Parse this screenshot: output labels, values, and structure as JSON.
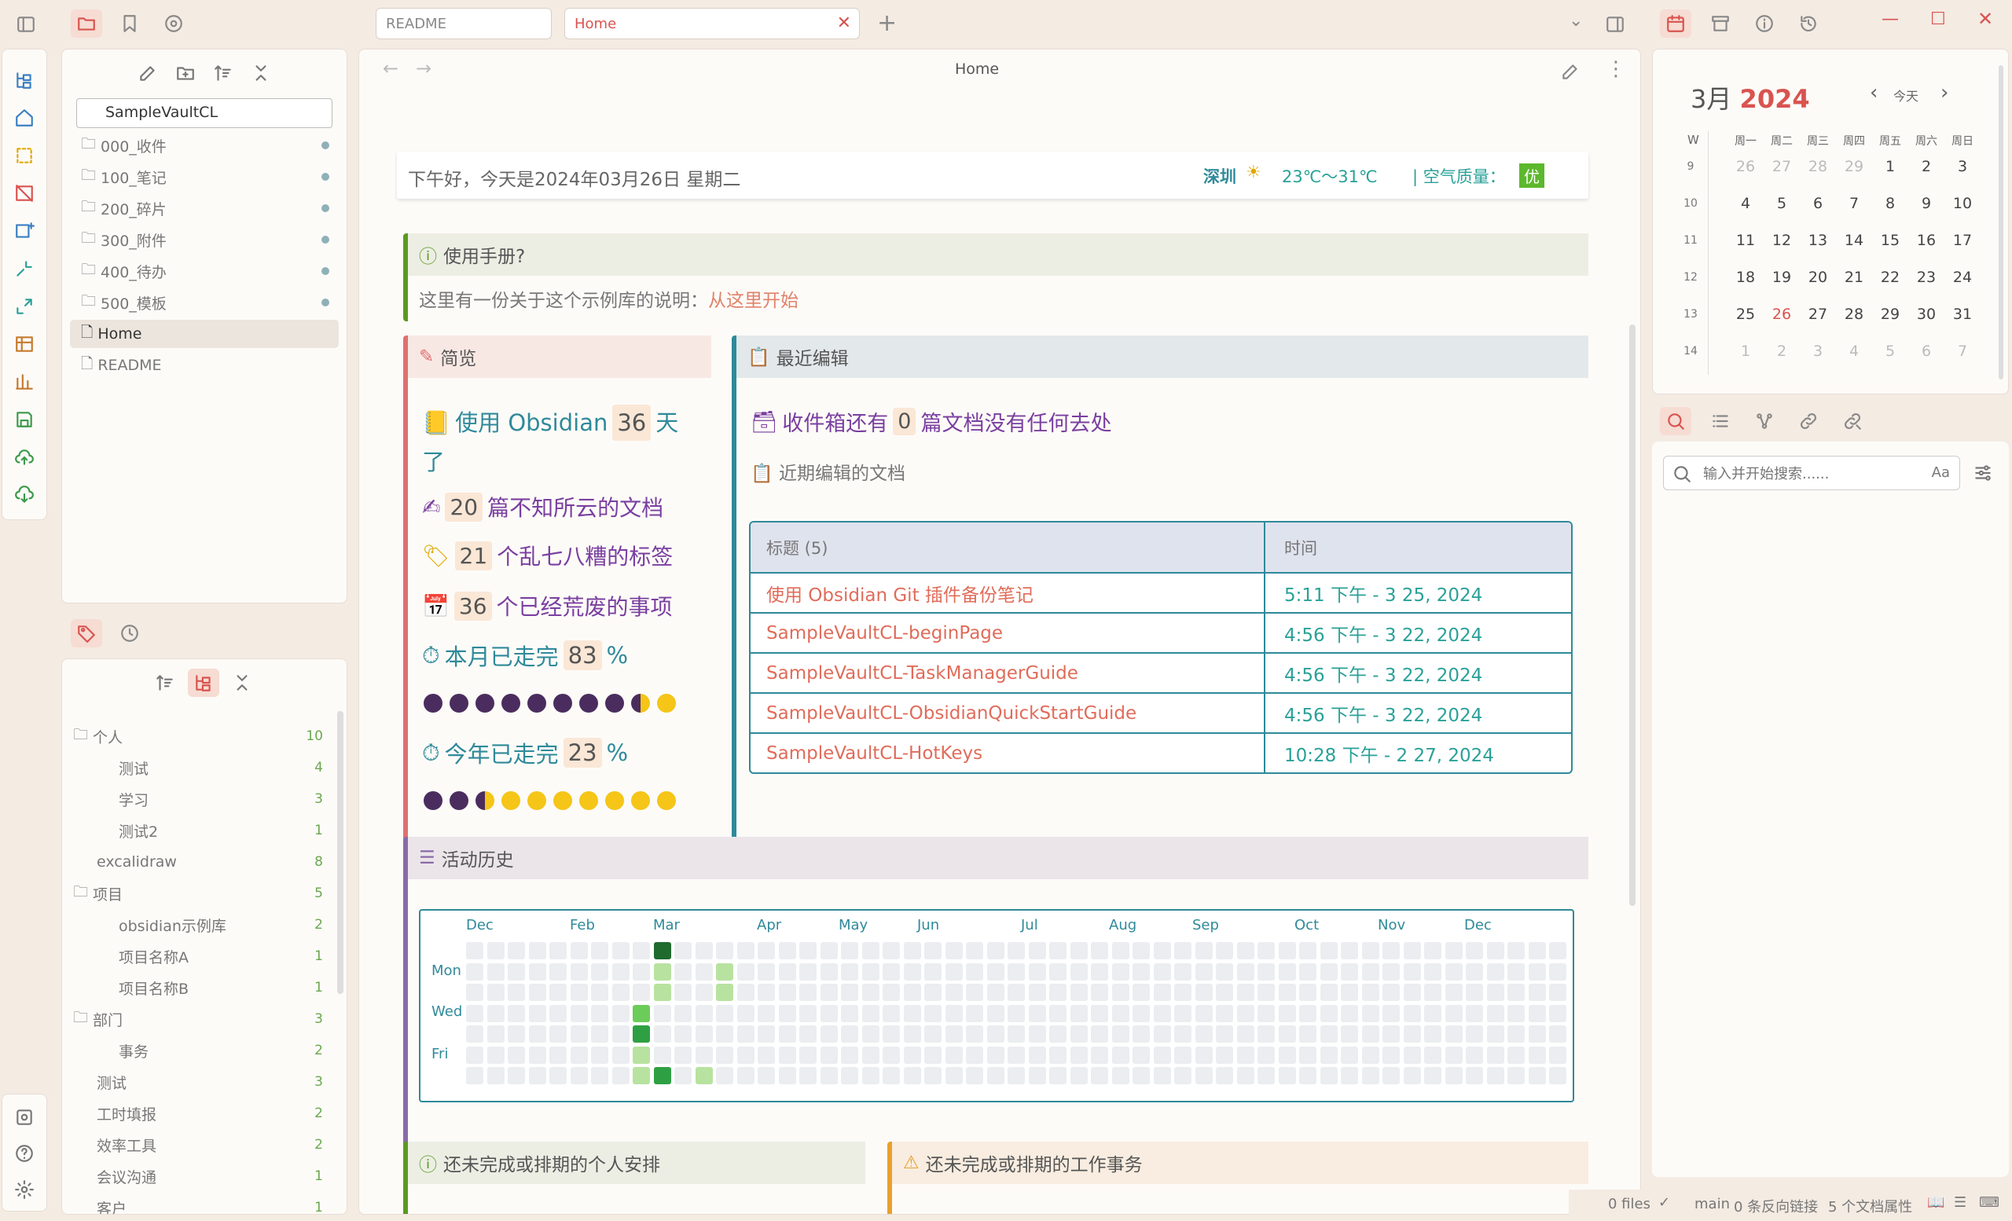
{
  "tabs": [
    {
      "label": "README"
    },
    {
      "label": "Home"
    }
  ],
  "file_tree": {
    "vault": "SampleVaultCL",
    "folders": [
      "000_收件",
      "100_笔记",
      "200_碎片",
      "300_附件",
      "400_待办",
      "500_模板"
    ],
    "files": [
      "Home",
      "README"
    ]
  },
  "tags": [
    {
      "label": "个人",
      "count": "10"
    },
    {
      "label": "测试",
      "count": "4"
    },
    {
      "label": "学习",
      "count": "3"
    },
    {
      "label": "测试2",
      "count": "1"
    },
    {
      "label": "excalidraw",
      "count": "8"
    },
    {
      "label": "项目",
      "count": "5"
    },
    {
      "label": "obsidian示例库",
      "count": "2"
    },
    {
      "label": "项目名称A",
      "count": "1"
    },
    {
      "label": "项目名称B",
      "count": "1"
    },
    {
      "label": "部门",
      "count": "3"
    },
    {
      "label": "事务",
      "count": "2"
    },
    {
      "label": "测试",
      "count": "3"
    },
    {
      "label": "工时填报",
      "count": "2"
    },
    {
      "label": "效率工具",
      "count": "2"
    },
    {
      "label": "会议沟通",
      "count": "1"
    },
    {
      "label": "客户",
      "count": "1"
    }
  ],
  "note": {
    "title": "Home"
  },
  "greeting": {
    "text": "下午好，今天是2024年03月26日 星期二",
    "city": "深圳",
    "temp": "23℃～31℃",
    "aq_label": "| 空气质量：",
    "aq_value": "优"
  },
  "manual": {
    "title": "使用手册?",
    "text": "这里有一份关于这个示例库的说明：",
    "link": "从这里开始"
  },
  "overview": {
    "title": "简览",
    "s1a": "使用 Obsidian",
    "s1n": "36",
    "s1b": "天",
    "s1c": "了",
    "s2n": "20",
    "s2": "篇不知所云的文档",
    "s3n": "21",
    "s3": "个乱七八糟的标签",
    "s4n": "36",
    "s4": "个已经荒废的事项",
    "s5a": "本月已走完",
    "s5n": "83",
    "s5b": "%",
    "s6a": "今年已走完",
    "s6n": "23",
    "s6b": "%"
  },
  "recent": {
    "title": "最近编辑",
    "inbox_a": "收件箱还有",
    "inbox_n": "0",
    "inbox_b": "篇文档没有任何去处",
    "sub": "近期编辑的文档",
    "col1": "标题 (5)",
    "col2": "时间",
    "rows": [
      {
        "t": "使用 Obsidian Git 插件备份笔记",
        "d": "5:11 下午 - 3 25, 2024"
      },
      {
        "t": "SampleVaultCL-beginPage",
        "d": "4:56 下午 - 3 22, 2024"
      },
      {
        "t": "SampleVaultCL-TaskManagerGuide",
        "d": "4:56 下午 - 3 22, 2024"
      },
      {
        "t": "SampleVaultCL-ObsidianQuickStartGuide",
        "d": "4:56 下午 - 3 22, 2024"
      },
      {
        "t": "SampleVaultCL-HotKeys",
        "d": "10:28 下午 - 2 27, 2024"
      }
    ]
  },
  "history": {
    "title": "活动历史",
    "months": [
      "Dec",
      "Feb",
      "Mar",
      "Apr",
      "May",
      "Jun",
      "Jul",
      "Aug",
      "Sep",
      "Oct",
      "Nov",
      "Dec"
    ],
    "days": [
      "Mon",
      "Wed",
      "Fri"
    ]
  },
  "personal": {
    "title": "还未完成或排期的个人安排"
  },
  "work": {
    "title": "还未完成或排期的工作事务"
  },
  "calendar": {
    "month": "3月",
    "year": "2024",
    "today": "今天",
    "week_label": "W",
    "weekdays": [
      "周一",
      "周二",
      "周三",
      "周四",
      "周五",
      "周六",
      "周日"
    ],
    "weeks": [
      {
        "w": "9",
        "d": [
          "26",
          "27",
          "28",
          "29",
          "1",
          "2",
          "3"
        ]
      },
      {
        "w": "10",
        "d": [
          "4",
          "5",
          "6",
          "7",
          "8",
          "9",
          "10"
        ]
      },
      {
        "w": "11",
        "d": [
          "11",
          "12",
          "13",
          "14",
          "15",
          "16",
          "17"
        ]
      },
      {
        "w": "12",
        "d": [
          "18",
          "19",
          "20",
          "21",
          "22",
          "23",
          "24"
        ]
      },
      {
        "w": "13",
        "d": [
          "25",
          "26",
          "27",
          "28",
          "29",
          "30",
          "31"
        ]
      },
      {
        "w": "14",
        "d": [
          "1",
          "2",
          "3",
          "4",
          "5",
          "6",
          "7"
        ]
      }
    ]
  },
  "search": {
    "placeholder": "输入并开始搜索......",
    "case": "Aa"
  },
  "status": {
    "files": "0 files",
    "branch": "main",
    "backlinks": "0 条反向链接",
    "props": "5 个文档属性"
  }
}
